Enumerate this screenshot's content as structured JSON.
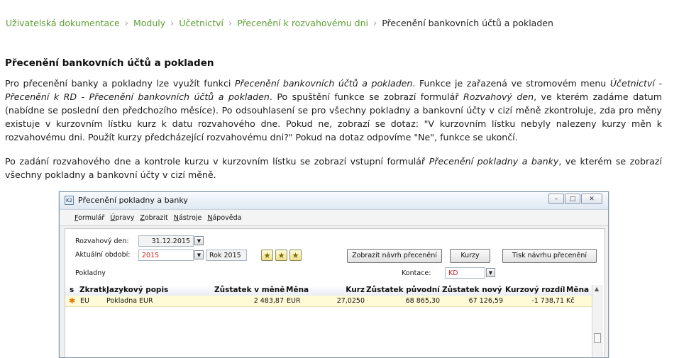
{
  "breadcrumb": {
    "items": [
      "Uživatelská dokumentace",
      "Moduly",
      "Účetnictví",
      "Přecenění k rozvahovému dni"
    ],
    "current": "Přecenění bankovních účtů a pokladen",
    "separator": "›"
  },
  "page_title": "Přecenění bankovních účtů a pokladen",
  "paragraph1": {
    "t1": "Pro přecenění banky a pokladny lze využít funkci ",
    "i1": "Přecenění bankovních účtů a pokladen",
    "t2": ". Funkce je zařazená ve stromovém menu ",
    "i2": "Účetnictví - Přecenění k RD - Přecenění bankovních účtů a pokladen",
    "t3": ". Po spuštění funkce se zobrazí formulář ",
    "i3": "Rozvahový den",
    "t4": ", ve kterém zadáme datum (nabídne se poslední den předchozího měsíce). Po odsouhlasení se pro všechny pokladny a bankovní účty v cizí měně zkontroluje, zda pro měny existuje v kurzovním lístku kurz k datu rozvahového dne. Pokud ne, zobrazí se dotaz: \"V kurzovním lístku nebyly nalezeny kurzy měn k rozvahovému dni. Použít kurzy předcházející rozvahovému dni?\" Pokud na dotaz odpovíme \"Ne\", funkce se ukončí."
  },
  "paragraph2": {
    "t1": "Po zadání rozvahového dne a kontrole kurzu v kurzovním lístku se zobrazí vstupní formulář ",
    "i1": "Přecenění pokladny a banky",
    "t2": ", ve kterém se zobrazí všechny pokladny a bankovní účty v cizí měně."
  },
  "window": {
    "title": "Přecenění pokladny a banky",
    "icon_text": "K2",
    "controls": {
      "minimize": "–",
      "maximize": "□",
      "close": "✕"
    },
    "menu": [
      "Formulář",
      "Úpravy",
      "Zobrazit",
      "Nástroje",
      "Nápověda"
    ],
    "form": {
      "rozvahovy_den_label": "Rozvahový den:",
      "rozvahovy_den_value": "31.12.2015",
      "aktualni_obdobi_label": "Aktuální období:",
      "aktualni_obdobi_value": "2015",
      "obdobi_name": "Rok 2015",
      "pokladny_label": "Pokladny",
      "kontace_label": "Kontace:",
      "kontace_value": "KD",
      "btn_zobrazit": "Zobrazit návrh přecenění",
      "btn_kurzy": "Kurzy",
      "btn_tisk": "Tisk návrhu přecenění"
    },
    "grid": {
      "columns": [
        "s",
        "Zkratk",
        "Jazykový popis",
        "Zůstatek v měně",
        "Měna",
        "Kurz",
        "Zůstatek původní",
        "Zůstatek nový",
        "Kurzový rozdíl",
        "Měna"
      ],
      "rows": [
        {
          "marker": "✱",
          "zkratka": "EU",
          "popis": "Pokladna EUR",
          "zustatek_mena": "2 483,87",
          "mena": "EUR",
          "kurz": "27,0250",
          "puvodni": "68 865,30",
          "novy": "67 126,59",
          "rozdil": "-1 738,71",
          "mena2": "Kč"
        }
      ]
    }
  },
  "colors": {
    "link": "#5b9e32",
    "row_highlight": "#fffbd6",
    "red_value": "#d21b1b"
  },
  "icons": [
    "chevron-right-icon",
    "star-icon",
    "star-plus-icon",
    "star-edit-icon",
    "dropdown-arrow-icon"
  ]
}
